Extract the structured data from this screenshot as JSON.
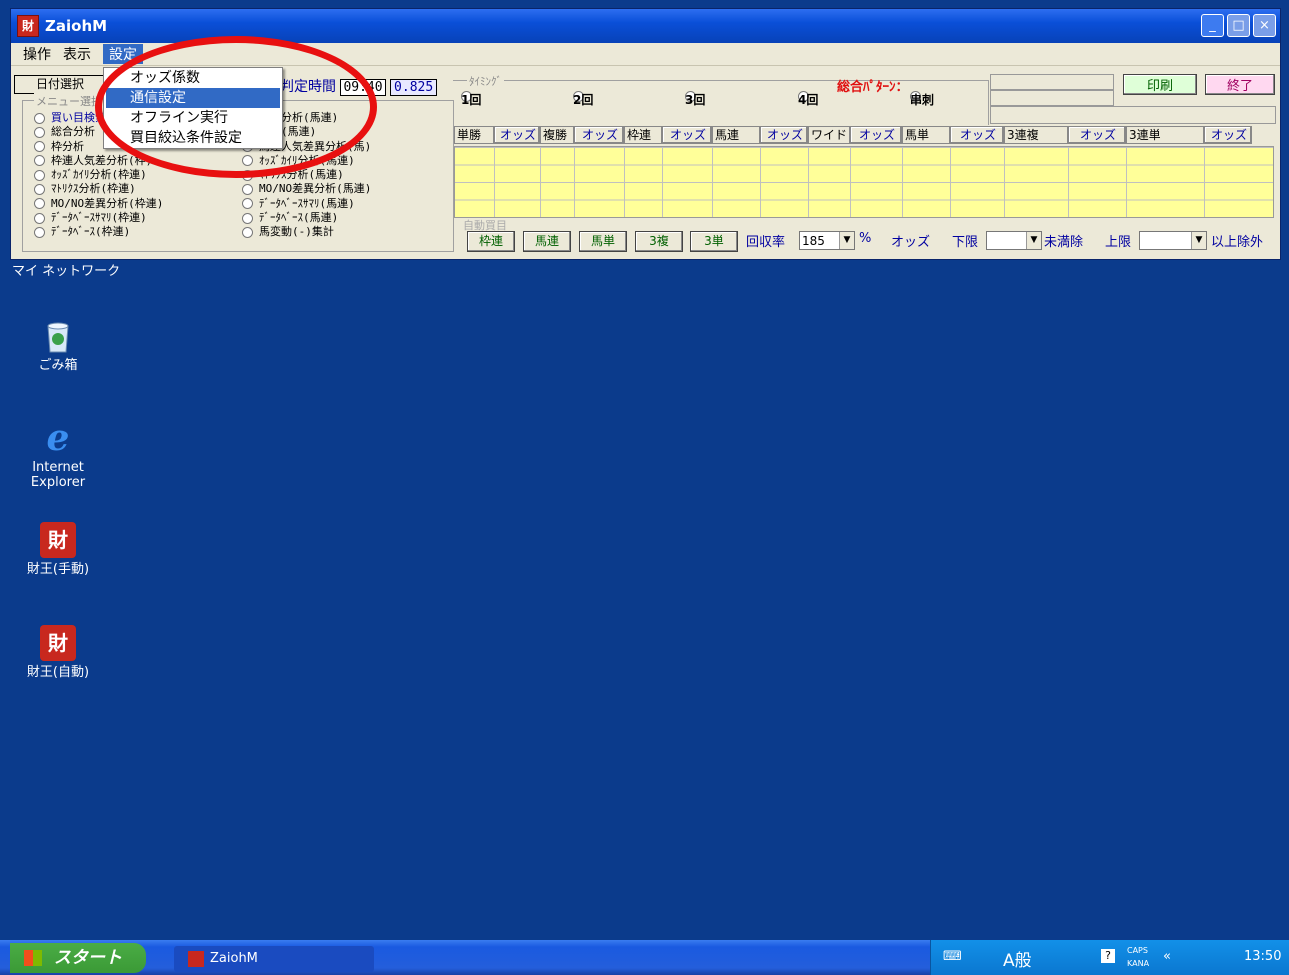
{
  "window": {
    "title": "ZaiohM",
    "app_icon": "財",
    "buttons": {
      "minimize": "_",
      "maximize": "□",
      "close": "×"
    }
  },
  "menu": {
    "items": [
      "操作",
      "表示",
      "設定"
    ],
    "dropdown": [
      "オッズ係数",
      "通信設定",
      "オフライン実行",
      "買目絞込条件設定"
    ]
  },
  "left": {
    "date_button": "日付選択",
    "menu_group": "メニュー選択",
    "menu_col1": [
      "買い目検索",
      "総合分析",
      "枠分析",
      "枠連人気差分析(枠)",
      "ｵｯｽﾞｶｲﾘ分析(枠連)",
      "ﾏﾄﾘｸｽ分析(枠連)",
      "MO/NO差異分析(枠連)",
      "ﾃﾞｰﾀﾍﾞｰｽｻﾏﾘ(枠連)",
      "ﾃﾞｰﾀﾍﾞｰｽ(枠連)"
    ],
    "menu_col2": [
      "総合分析(馬連)",
      "分析(馬連)",
      "馬連人気差異分析(馬)",
      "ｵｯｽﾞｶｲﾘ分析(馬連)",
      "ﾏﾄﾘｸｽ分析(馬連)",
      "MO/NO差異分析(馬連)",
      "ﾃﾞｰﾀﾍﾞｰｽｻﾏﾘ(馬連)",
      "ﾃﾞｰﾀﾍﾞｰｽ(馬連)",
      "馬変動(-)集計"
    ],
    "judge_label": "判定時間",
    "judge_time": "09:40",
    "judge_value": "0.825"
  },
  "timing": {
    "label": "ﾀｲﾐﾝｸﾞ",
    "options": [
      "1回",
      "2回",
      "3回",
      "4回",
      "串刺"
    ],
    "pattern_label": "総合ﾊﾟﾀｰﾝ："
  },
  "actions": {
    "print": "印刷",
    "exit": "終了"
  },
  "odds_header": [
    "単勝",
    "オッズ",
    "複勝",
    "オッズ",
    "枠連",
    "オッズ",
    "馬連",
    "オッズ",
    "ワイド",
    "オッズ",
    "馬単",
    "オッズ",
    "3連複",
    "オッズ",
    "3連単",
    "オッズ"
  ],
  "autobet": {
    "label": "自動買目",
    "buttons": [
      "枠連",
      "馬連",
      "馬単",
      "3複",
      "3単"
    ],
    "return_label": "回収率",
    "return_value": "185",
    "percent": "%",
    "odds_label": "オッズ",
    "lower_label": "下限",
    "below_label": "未満除",
    "upper_label": "上限",
    "above_label": "以上除外"
  },
  "desktop": {
    "network": "マイ ネットワーク",
    "icons": [
      {
        "name": "recycle-bin-icon",
        "label": "ごみ箱"
      },
      {
        "name": "internet-explorer-icon",
        "label": "Internet Explorer"
      },
      {
        "name": "zaioh-manual-icon",
        "label": "財王(手動)"
      },
      {
        "name": "zaioh-auto-icon",
        "label": "財王(自動)"
      }
    ]
  },
  "taskbar": {
    "start": "スタート",
    "task": "ZaiohM",
    "ime": "A般",
    "caps": "CAPS",
    "kana": "KANA",
    "clock": "13:50"
  }
}
